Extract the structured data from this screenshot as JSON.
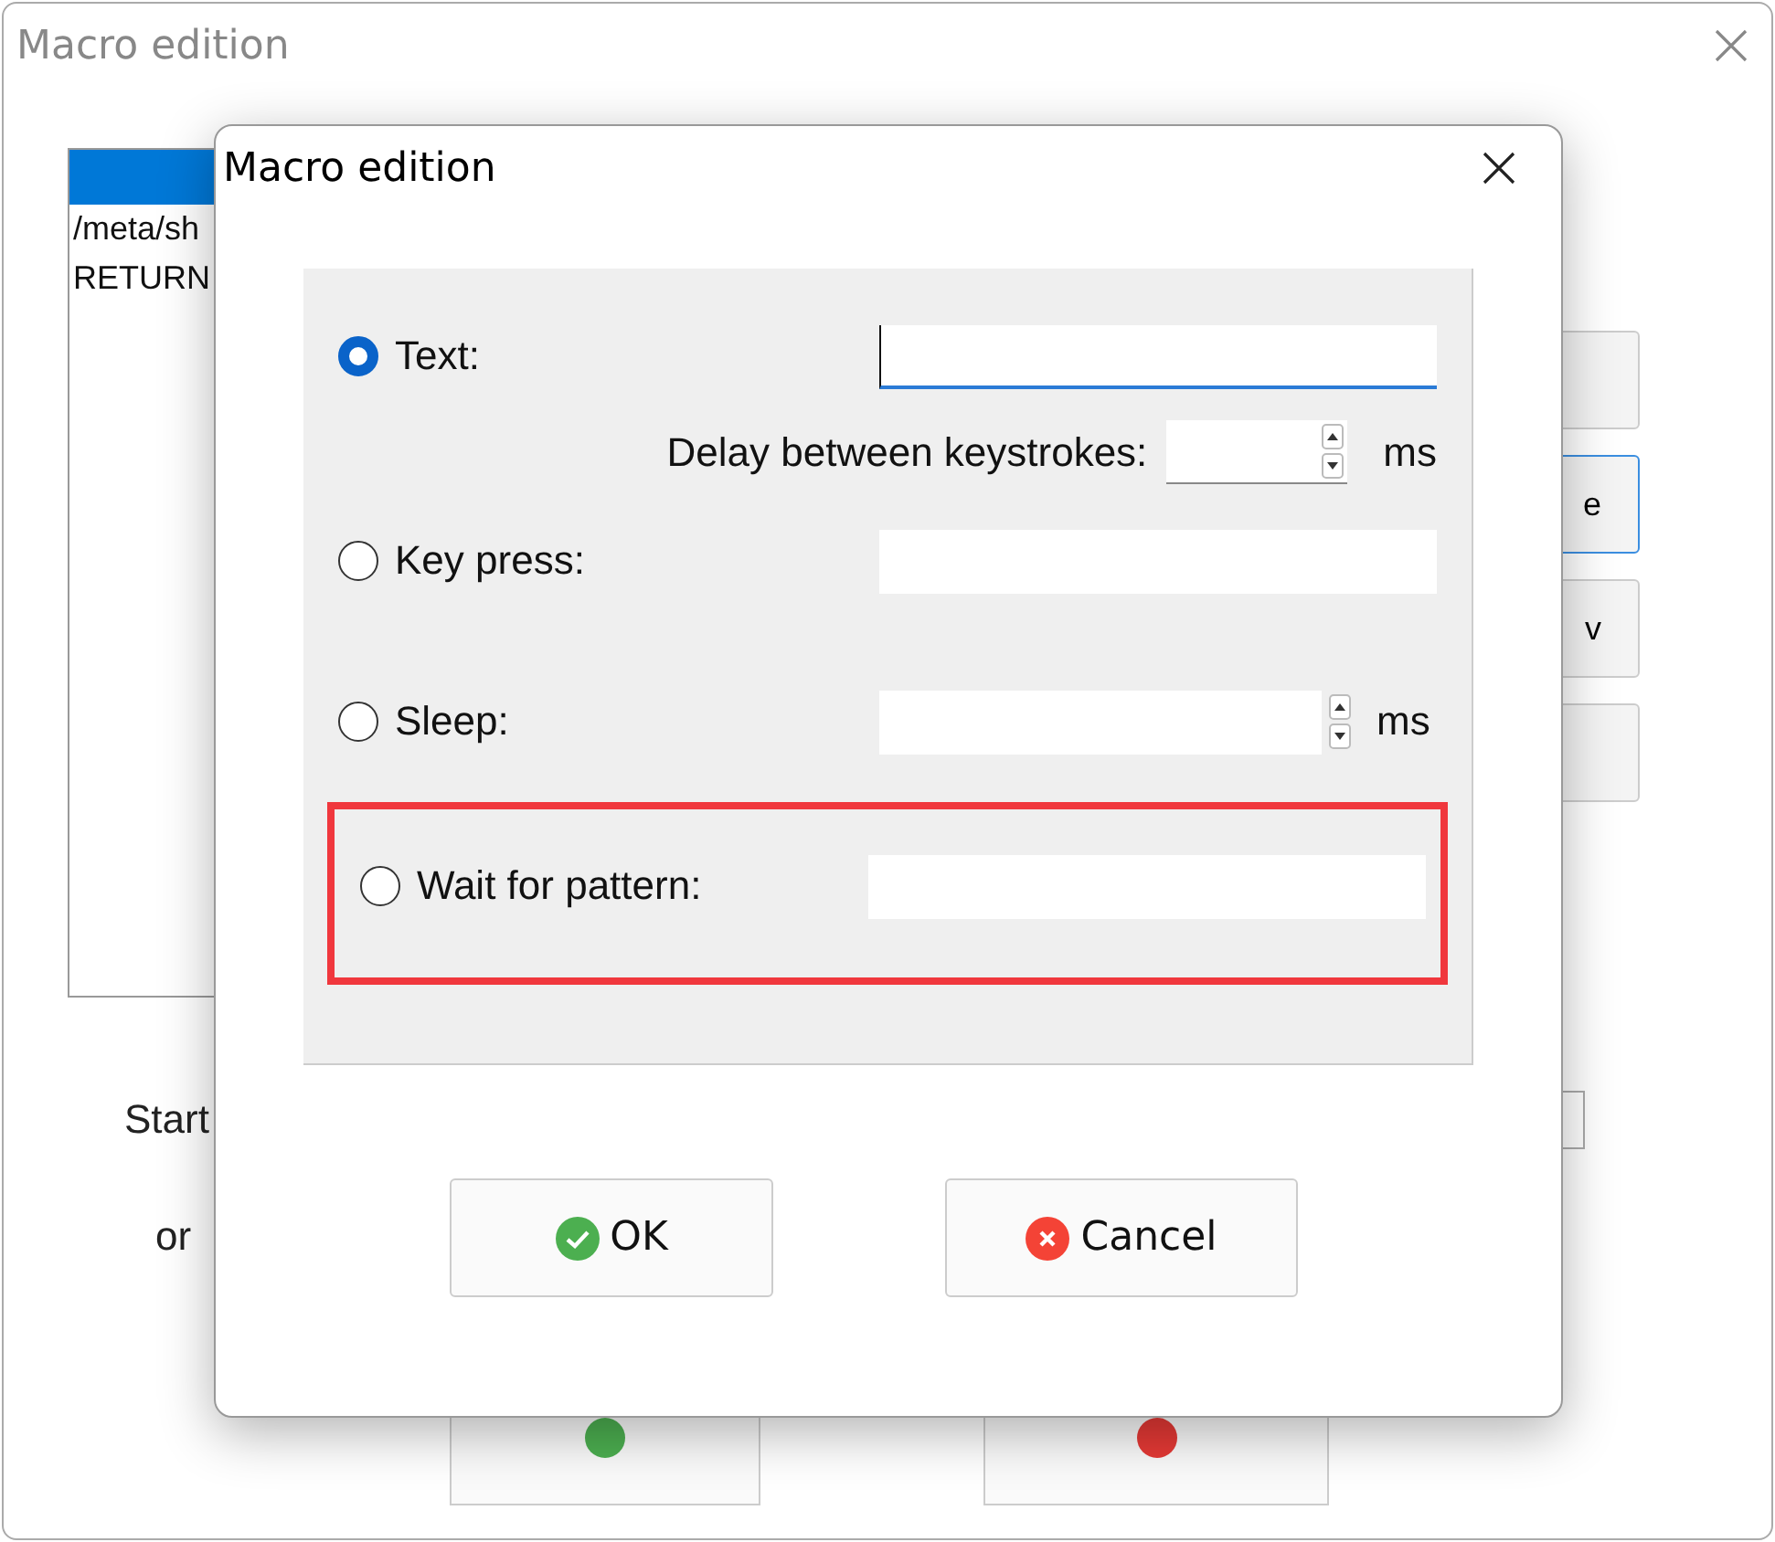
{
  "main_window": {
    "title": "Macro edition",
    "list_items": [
      {
        "selected": true
      },
      {
        "text": "/meta/sh",
        "selected": false
      },
      {
        "text": "RETURN",
        "selected": false
      }
    ],
    "side_buttons": [
      {
        "focused": false
      },
      {
        "text": "e",
        "focused": true
      },
      {
        "text": "v",
        "focused": false
      },
      {
        "focused": false
      }
    ],
    "start_label": "Start",
    "or_label": "or"
  },
  "dialog": {
    "title": "Macro edition",
    "options": [
      {
        "kind": "text",
        "label": "Text:",
        "selected": true,
        "highlighted": false,
        "sub": {
          "label": "Delay between keystrokes:",
          "unit": "ms"
        }
      },
      {
        "kind": "plain",
        "label": "Key press:",
        "selected": false,
        "highlighted": false
      },
      {
        "kind": "spin",
        "label": "Sleep:",
        "selected": false,
        "highlighted": false,
        "unit": "ms"
      },
      {
        "kind": "plain",
        "label": "Wait for pattern:",
        "selected": false,
        "highlighted": true
      }
    ],
    "buttons": [
      {
        "kind": "ok",
        "label": "OK"
      },
      {
        "kind": "cancel",
        "label": "Cancel"
      }
    ]
  }
}
